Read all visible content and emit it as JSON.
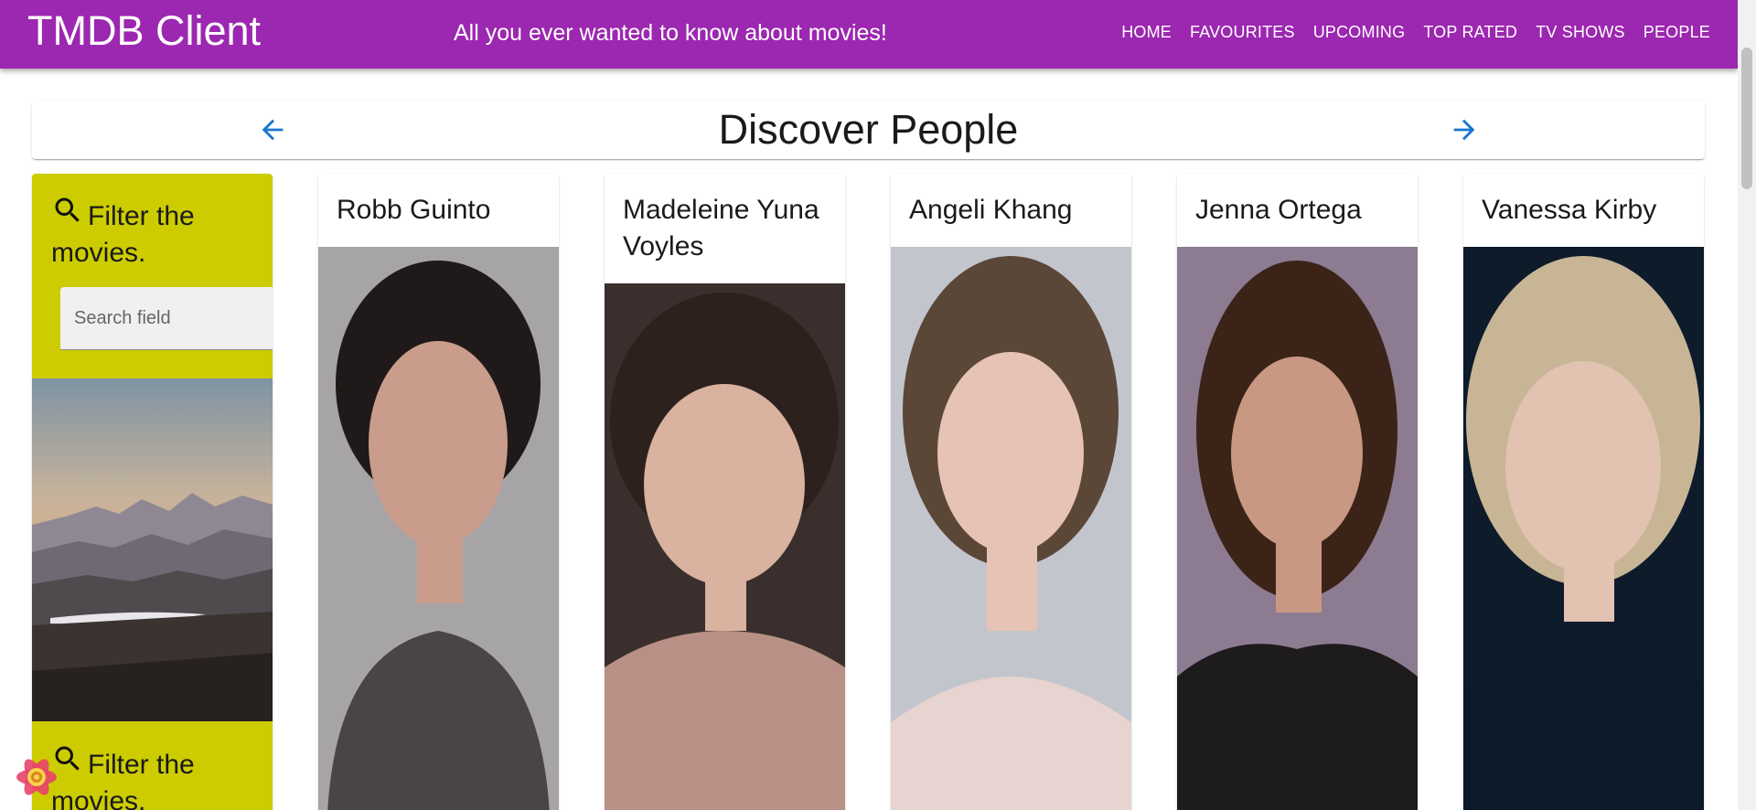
{
  "app": {
    "brand": "TMDB Client",
    "tagline": "All you ever wanted to know about movies!",
    "nav": [
      "HOME",
      "FAVOURITES",
      "UPCOMING",
      "TOP RATED",
      "TV SHOWS",
      "PEOPLE"
    ]
  },
  "header": {
    "title": "Discover People",
    "left_icon": "arrow-back-icon",
    "right_icon": "arrow-forward-icon"
  },
  "filter": {
    "title": "Filter the movies.",
    "search_placeholder": "Search field",
    "second_title": "Filter the movies."
  },
  "people": [
    {
      "name": "Robb Guinto",
      "bg": "#a7a4a8",
      "hair": "#1f1a19",
      "skin": "#c99c8c",
      "top": "#4a4545"
    },
    {
      "name": "Madeleine Yuna Voyles",
      "bg": "#3a2f2c",
      "hair": "#2c211d",
      "skin": "#d9b2a0",
      "top": "#b89085"
    },
    {
      "name": "Angeli Khang",
      "bg": "#c3c5cd",
      "hair": "#5b4738",
      "skin": "#e6c3b4",
      "top": "#e7d3cf"
    },
    {
      "name": "Jenna Ortega",
      "bg": "#8c7b91",
      "hair": "#3b2317",
      "skin": "#c99882",
      "top": "#1d1b1c"
    },
    {
      "name": "Vanessa Kirby",
      "bg": "#0d1b2a",
      "hair": "#c8b596",
      "skin": "#e2c3b2",
      "top": "#0c1a29"
    }
  ],
  "colors": {
    "appbar": "#9c27b0",
    "filter_card": "#cccc00",
    "arrow": "#1976d2"
  }
}
